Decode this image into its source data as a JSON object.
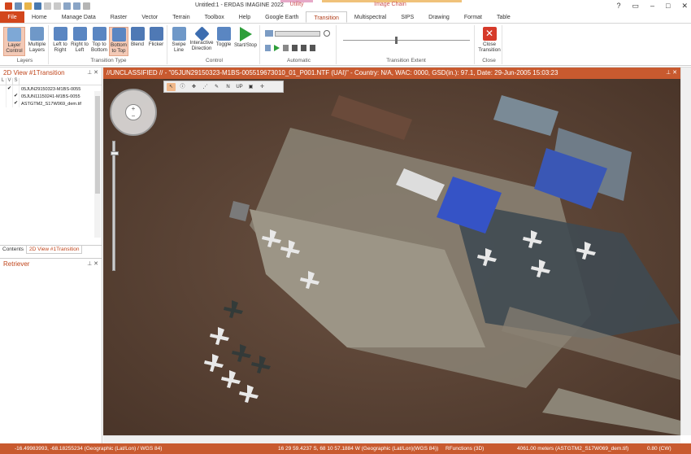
{
  "app": {
    "title": "Untitled:1 - ERDAS IMAGINE 2022",
    "context_utility": "Utility",
    "context_image_chain": "Image Chain"
  },
  "tabs": [
    "File",
    "Home",
    "Manage Data",
    "Raster",
    "Vector",
    "Terrain",
    "Toolbox",
    "Help",
    "Google Earth",
    "Transition",
    "Multispectral",
    "SIPS",
    "Drawing",
    "Format",
    "Table"
  ],
  "ribbon": {
    "layers_group": "Layers",
    "layer_control": "Layer Control",
    "multiple_layers": "Multiple Layers",
    "transition_type_group": "Transition Type",
    "left_to_right": "Left to Right",
    "right_to_left": "Right to Left",
    "top_to_bottom": "Top to Bottom",
    "bottom_to_top": "Bottom to Top",
    "blend": "Blend",
    "flicker": "Flicker",
    "control_group": "Control",
    "swipe_line": "Swipe Line",
    "interactive_direction": "Interactive Direction",
    "toggle": "Toggle",
    "start_stop": "Start/Stop",
    "automatic_group": "Automatic",
    "transition_extent_group": "Transition Extent",
    "close_group": "Close",
    "close_transition": "Close Transition"
  },
  "left_panel": {
    "title": "2D View #1Transition",
    "columns": [
      "L",
      "V",
      "S"
    ],
    "layers": [
      {
        "name": "05JUN29150323-M1BS-0055",
        "visible": "✔",
        "selected": false
      },
      {
        "name": "05JUN11150241-M1BS-0055",
        "visible": "✔",
        "selected": false
      },
      {
        "name": "ASTGTM2_S17W069_dem.tif",
        "visible": "✔",
        "selected": false
      }
    ],
    "tab_contents": "Contents",
    "tab_view": "2D View #1Transition",
    "retriever_title": "Retriever"
  },
  "viewer": {
    "title": "//UNCLASSIFIED // - \"05JUN29150323-M1BS-005519673010_01_P001.NTF (UAI)\" - Country: N/A, WAC: 0000, GSD(in.): 97.1, Date: 29-Jun-2005 15:03:23"
  },
  "status": {
    "coords1": "-16.49983993, -68.18255234  (Geographic (Lat/Lon) / WGS 84)",
    "coords2": "16 29 59.4237 S,  68 10 57.1884 W (Geographic (Lat/Lon)(WGS 84))",
    "rfunctions": "RFunctions (3D)",
    "scale": "4061.00 meters (ASTGTM2_S17W069_dem.tif)",
    "rotation": "0.80 (CW)"
  },
  "colors": {
    "accent": "#c85a2f",
    "file_tab": "#d2461c",
    "selected_button": "#f3c9b6"
  }
}
